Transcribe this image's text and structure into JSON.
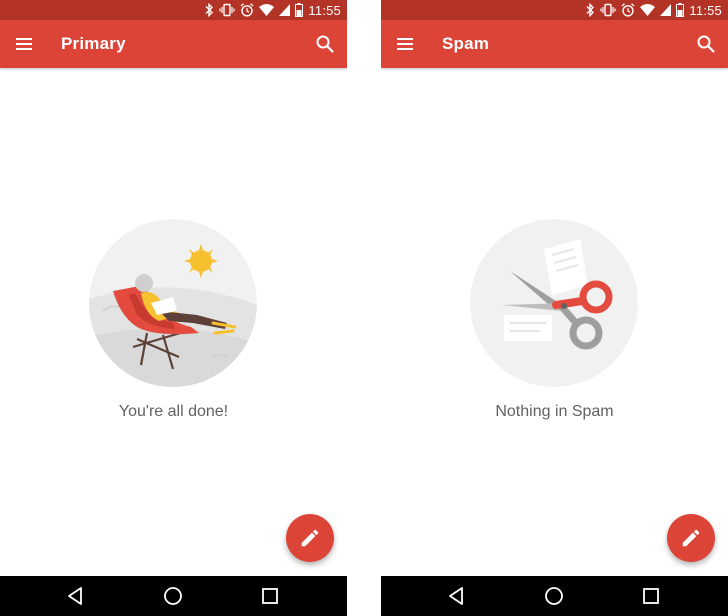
{
  "screens": [
    {
      "title": "Primary",
      "empty_message": "You're all done!",
      "illustration_icon": "person-relaxing-in-lounge-chair",
      "status_time": "11:55"
    },
    {
      "title": "Spam",
      "empty_message": "Nothing in Spam",
      "illustration_icon": "scissors-cutting-paper",
      "status_time": "11:55"
    }
  ],
  "icons": {
    "menu": "hamburger-menu-icon",
    "search": "search-icon",
    "compose": "pencil-icon",
    "back": "back-triangle-icon",
    "home": "home-circle-icon",
    "recents": "recents-square-icon"
  },
  "colors": {
    "status_bar": "#b33426",
    "app_bar": "#db4437",
    "fab": "#db4437",
    "empty_text": "#616161",
    "nav_bar": "#000000"
  }
}
